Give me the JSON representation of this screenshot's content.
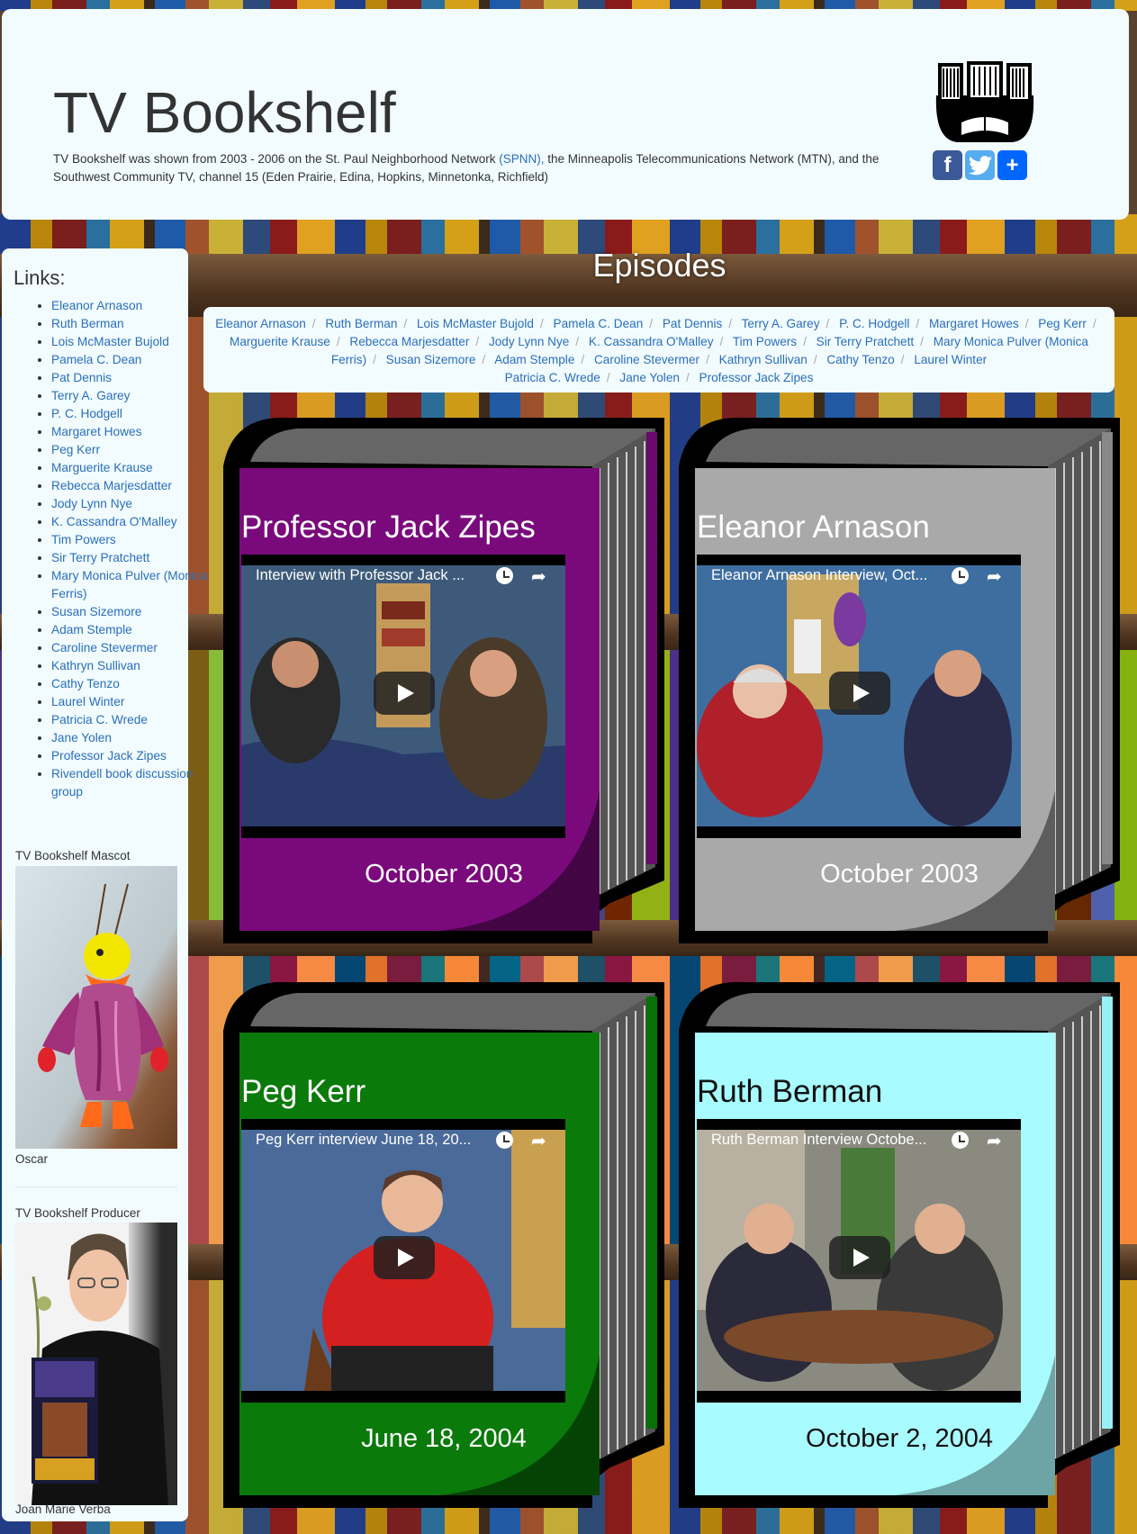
{
  "header": {
    "title": "TV Bookshelf",
    "description_before": "TV Bookshelf was shown from 2003 - 2006 on the St. Paul Neighborhood Network ",
    "spnn_link": "(SPNN),",
    "description_after": " the Minneapolis Telecommunications Network (MTN), and the Southwest Community TV, channel 15 (Eden Prairie, Edina, Hopkins, Minnetonka, Richfield)",
    "share_icons": [
      "facebook-icon",
      "twitter-icon",
      "add-share-icon"
    ]
  },
  "sidebar": {
    "links_title": "Links:",
    "links": [
      "Eleanor Arnason",
      "Ruth Berman",
      "Lois McMaster Bujold",
      "Pamela C. Dean",
      "Pat Dennis",
      "Terry A. Garey",
      "P. C. Hodgell",
      "Margaret Howes",
      "Peg Kerr",
      "Marguerite Krause",
      "Rebecca Marjesdatter",
      "Jody Lynn Nye",
      "K. Cassandra O'Malley",
      "Tim Powers",
      "Sir Terry Pratchett",
      "Mary Monica Pulver (Monica Ferris)",
      "Susan Sizemore",
      "Adam Stemple",
      "Caroline Stevermer",
      "Kathryn Sullivan",
      "Cathy Tenzo",
      "Laurel Winter",
      "Patricia C. Wrede",
      "Jane Yolen",
      "Professor Jack Zipes",
      "Rivendell book discussion group"
    ],
    "mascot_heading": "TV Bookshelf Mascot",
    "mascot_caption": "Oscar",
    "producer_heading": "TV Bookshelf Producer",
    "producer_caption": "Joan Marie Verba"
  },
  "episodes": {
    "title": "Episodes",
    "breadcrumb": [
      "Eleanor Arnason",
      "Ruth Berman",
      "Lois McMaster Bujold",
      "Pamela C. Dean",
      "Pat Dennis",
      "Terry A. Garey",
      "P. C. Hodgell",
      "Margaret Howes",
      "Peg Kerr",
      "Marguerite Krause",
      "Rebecca Marjesdatter",
      "Jody Lynn Nye",
      "K. Cassandra O'Malley",
      "Tim Powers",
      "Sir Terry Pratchett",
      "Mary Monica Pulver (Monica Ferris)",
      "Susan Sizemore",
      "Adam Stemple",
      "Caroline Stevermer",
      "Kathryn Sullivan",
      "Cathy Tenzo",
      "Laurel Winter",
      "Patricia C. Wrede",
      "Jane Yolen",
      "Professor Jack Zipes"
    ],
    "cards": [
      {
        "name": "Professor Jack Zipes",
        "video_title": "Interview with Professor Jack ...",
        "date": "October 2003",
        "cover_color": "#7a0a7c",
        "spine_color": "#6a0a6c"
      },
      {
        "name": "Eleanor Arnason",
        "video_title": "Eleanor Arnason Interview, Oct...",
        "date": "October 2003",
        "cover_color": "#a9a9a9",
        "spine_color": "#888888"
      },
      {
        "name": "Peg Kerr",
        "video_title": "Peg Kerr interview June 18, 20...",
        "date": "June 18, 2004",
        "cover_color": "#0a7a0a",
        "spine_color": "#087008"
      },
      {
        "name": "Ruth Berman",
        "video_title": "Ruth Berman Interview Octobe...",
        "date": "October 2, 2004",
        "cover_color": "#a8fcff",
        "spine_color": "#96f0f4"
      }
    ]
  }
}
